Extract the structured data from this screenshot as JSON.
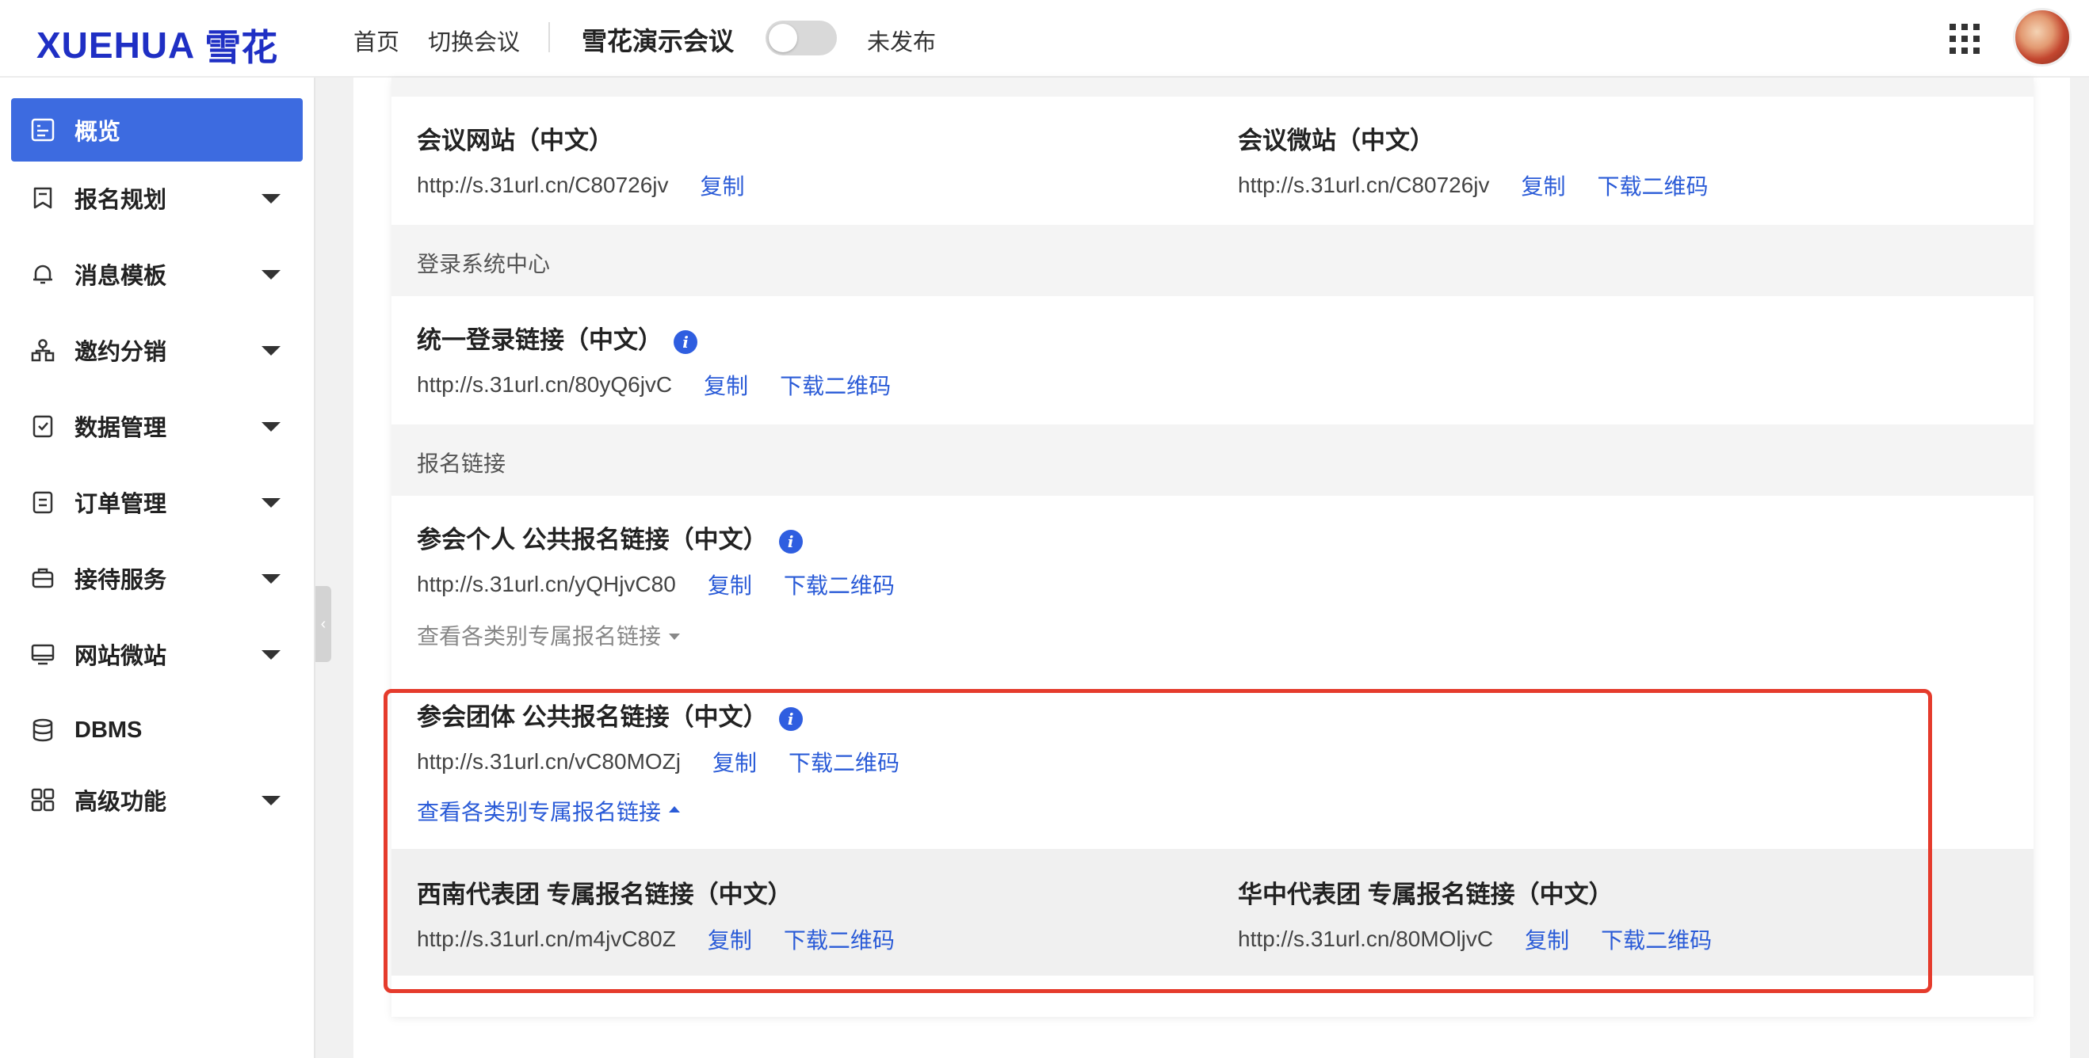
{
  "header": {
    "logo_en": "XUEHUA",
    "logo_cn": "雪花",
    "nav": [
      "首页",
      "切换会议"
    ],
    "conference_title": "雪花演示会议",
    "publish_status": "未发布",
    "publish_toggle_on": false
  },
  "sidebar": {
    "active_color": "#3d6be0",
    "items": [
      {
        "label": "概览",
        "icon": "overview-icon",
        "active": true
      },
      {
        "label": "报名规划",
        "icon": "bookmark-icon",
        "expandable": true
      },
      {
        "label": "消息模板",
        "icon": "bell-icon",
        "expandable": true
      },
      {
        "label": "邀约分销",
        "icon": "share-network-icon",
        "expandable": true
      },
      {
        "label": "数据管理",
        "icon": "checklist-icon",
        "expandable": true
      },
      {
        "label": "订单管理",
        "icon": "document-icon",
        "expandable": true
      },
      {
        "label": "接待服务",
        "icon": "suitcase-icon",
        "expandable": true
      },
      {
        "label": "网站微站",
        "icon": "monitor-icon",
        "expandable": true
      },
      {
        "label": "DBMS",
        "icon": "database-icon",
        "expandable": false
      },
      {
        "label": "高级功能",
        "icon": "grid-icon",
        "expandable": true
      }
    ]
  },
  "main": {
    "website": {
      "title": "会议网站（中文）",
      "url": "http://s.31url.cn/C80726jv",
      "copy": "复制"
    },
    "microsite": {
      "title": "会议微站（中文）",
      "url": "http://s.31url.cn/C80726jv",
      "copy": "复制",
      "qrcode": "下载二维码"
    },
    "login_section": {
      "heading": "登录系统中心",
      "title": "统一登录链接（中文）",
      "url": "http://s.31url.cn/80yQ6jvC",
      "copy": "复制",
      "qrcode": "下载二维码"
    },
    "registration_section": {
      "heading": "报名链接",
      "individual": {
        "title": "参会个人  公共报名链接（中文）",
        "url": "http://s.31url.cn/yQHjvC80",
        "copy": "复制",
        "qrcode": "下载二维码",
        "toggle": "查看各类别专属报名链接"
      },
      "group": {
        "title": "参会团体  公共报名链接（中文）",
        "url": "http://s.31url.cn/vC80MOZj",
        "copy": "复制",
        "qrcode": "下载二维码",
        "toggle": "查看各类别专属报名链接"
      },
      "exclusive": [
        {
          "title": "西南代表团  专属报名链接（中文）",
          "url": "http://s.31url.cn/m4jvC80Z",
          "copy": "复制",
          "qrcode": "下载二维码"
        },
        {
          "title": "华中代表团  专属报名链接（中文）",
          "url": "http://s.31url.cn/80MOljvC",
          "copy": "复制",
          "qrcode": "下载二维码"
        }
      ]
    }
  },
  "colors": {
    "link": "#2a5bd7",
    "highlight_border": "#e53b2c",
    "info_icon": "#2f5ee0"
  }
}
